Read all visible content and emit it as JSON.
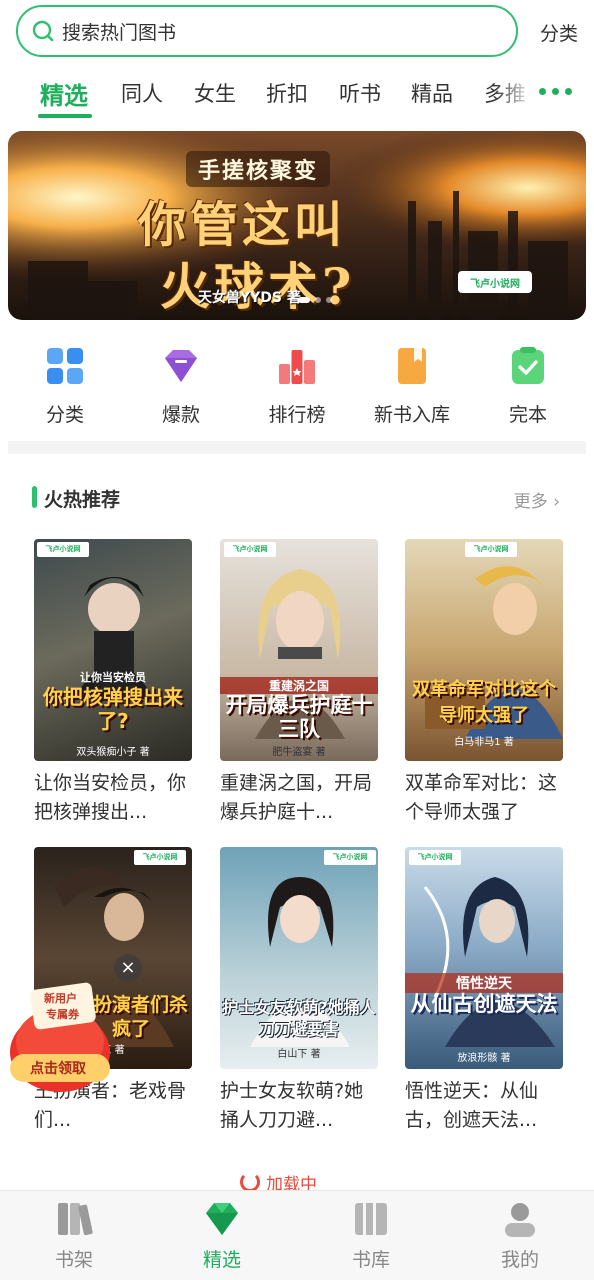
{
  "search": {
    "placeholder": "搜索热门图书",
    "category_link": "分类"
  },
  "tabs": [
    {
      "label": "精选",
      "active": true
    },
    {
      "label": "同人"
    },
    {
      "label": "女生"
    },
    {
      "label": "折扣"
    },
    {
      "label": "听书"
    },
    {
      "label": "精品"
    },
    {
      "label": "多推"
    }
  ],
  "banner": {
    "subtitle": "手搓核聚变",
    "title_line1": "你管这叫",
    "title_line2": "火球术?",
    "author": "天女兽YYDS 著",
    "logo": "飞卢小说网"
  },
  "quick_entries": [
    {
      "label": "分类",
      "icon": "grid-icon",
      "color": "#3a8ef0"
    },
    {
      "label": "爆款",
      "icon": "gem-icon",
      "color": "#9b59d6"
    },
    {
      "label": "排行榜",
      "icon": "ranking-icon",
      "color": "#ef4b4b"
    },
    {
      "label": "新书入库",
      "icon": "new-book-icon",
      "color": "#f5a23a"
    },
    {
      "label": "完本",
      "icon": "completed-icon",
      "color": "#4ccf6e"
    }
  ],
  "section": {
    "title": "火热推荐",
    "more": "更多"
  },
  "books": [
    {
      "title": "让你当安检员，你把核弹搜出...",
      "cover_sub": "让你当安检员",
      "cover_main": "你把核弹搜出来了?",
      "cover_author": "双头猴痴小子 著"
    },
    {
      "title": "重建涡之国，开局爆兵护庭十...",
      "cover_sub": "重建涡之国",
      "cover_main": "开局爆兵护庭十三队",
      "cover_author": "肥牛盗宴 著"
    },
    {
      "title": "双革命军对比：这个导师太强了",
      "cover_sub": "",
      "cover_main": "双革命军对比这个导师太强了",
      "cover_author": "白马非马1 著"
    },
    {
      "title": "王扮演者：老戏骨们...",
      "cover_sub": "",
      "cover_main": "王扮演者们杀疯了",
      "cover_author": "王 著"
    },
    {
      "title": "护士女友软萌?她捅人刀刀避...",
      "cover_sub": "",
      "cover_main": "护士女友软萌?她捅人刀刀避要害",
      "cover_author": "白山下 著"
    },
    {
      "title": "悟性逆天：从仙古，创遮天法...",
      "cover_sub": "悟性逆天",
      "cover_main": "从仙古创遮天法",
      "cover_author": "放浪形骸 著"
    }
  ],
  "coupon": {
    "line1": "新用户",
    "line2": "专属券",
    "button": "点击领取"
  },
  "loading": {
    "text": "加载中"
  },
  "bottom_nav": [
    {
      "label": "书架",
      "icon": "bookshelf-icon"
    },
    {
      "label": "精选",
      "icon": "diamond-icon",
      "active": true
    },
    {
      "label": "书库",
      "icon": "library-icon"
    },
    {
      "label": "我的",
      "icon": "profile-icon"
    }
  ]
}
